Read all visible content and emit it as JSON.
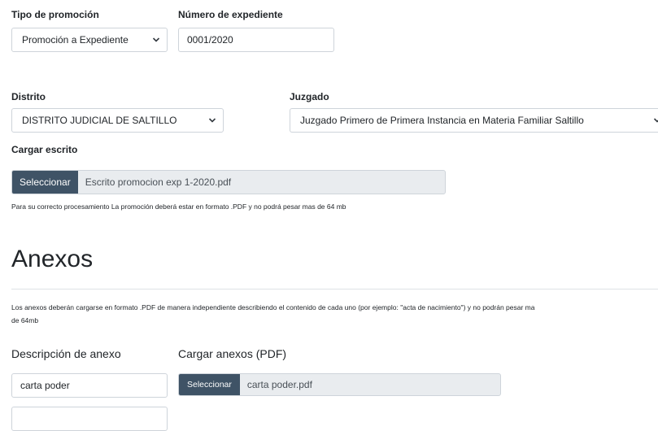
{
  "promotion": {
    "type_label": "Tipo de promoción",
    "type_value": "Promoción a Expediente",
    "file_number_label": "Número de expediente",
    "file_number_value": "0001/2020"
  },
  "location": {
    "district_label": "Distrito",
    "district_value": "DISTRITO JUDICIAL DE SALTILLO",
    "court_label": "Juzgado",
    "court_value": "Juzgado Primero de Primera Instancia en Materia Familiar Saltillo"
  },
  "upload": {
    "label": "Cargar escrito",
    "button": "Seleccionar",
    "filename": "Escrito promocion exp 1-2020.pdf",
    "help": "Para su correcto procesamiento La promoción deberá estar en formato .PDF y no podrá pesar mas de 64 mb"
  },
  "annexes": {
    "heading": "Anexos",
    "note_line1": "Los anexos deberán cargarse en formato .PDF de manera independiente describiendo el contenido de cada uno (por ejemplo: \"acta de nacimiento\") y no podrán pesar ma",
    "note_line2": "de 64mb",
    "description_header": "Descripción de anexo",
    "upload_header": "Cargar anexos (PDF)",
    "rows": [
      {
        "description": "carta poder",
        "button": "Seleccionar",
        "filename": "carta poder.pdf"
      },
      {
        "description": ""
      }
    ]
  },
  "colors": {
    "button_bg": "#3f5366",
    "file_bg": "#e9ecef",
    "border": "#ced4da",
    "divider": "#dee2e6"
  },
  "icons": {
    "select_arrow": "chevron-down-icon"
  }
}
